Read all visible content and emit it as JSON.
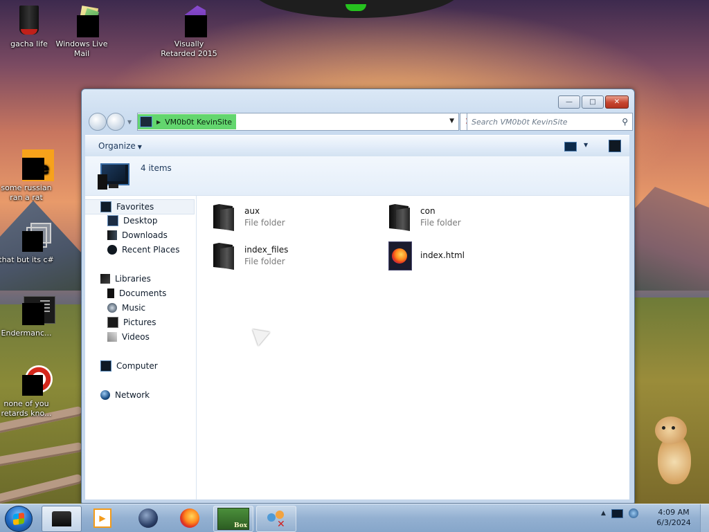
{
  "desktop": {
    "icons": [
      {
        "label": "gacha life",
        "icon": "trash-can-icon"
      },
      {
        "label": "Windows Live Mail",
        "icon": "mail-icon"
      },
      {
        "label": "Visually Retarded 2015",
        "icon": "visual-studio-icon"
      },
      {
        "label": "some russian ran a rat",
        "icon": "app-icon"
      },
      {
        "label": "that but its c#",
        "icon": "app-icon"
      },
      {
        "label": "Endermanc...",
        "icon": "app-icon"
      },
      {
        "label": "none of you retards kno...",
        "icon": "app-icon"
      }
    ]
  },
  "explorer": {
    "address": {
      "segment": "VM0b0t KevinSite"
    },
    "search": {
      "placeholder": "Search VM0b0t KevinSite"
    },
    "toolbar": {
      "organize_label": "Organize"
    },
    "details": {
      "items_count": "4 items"
    },
    "nav": {
      "favorites": {
        "label": "Favorites",
        "items": [
          "Desktop",
          "Downloads",
          "Recent Places"
        ]
      },
      "libraries": {
        "label": "Libraries",
        "items": [
          "Documents",
          "Music",
          "Pictures",
          "Videos"
        ]
      },
      "computer": {
        "label": "Computer"
      },
      "network": {
        "label": "Network"
      }
    },
    "files": [
      {
        "name": "aux",
        "type": "File folder"
      },
      {
        "name": "con",
        "type": "File folder"
      },
      {
        "name": "index_files",
        "type": "File folder"
      },
      {
        "name": "index.html",
        "type": ""
      }
    ]
  },
  "taskbar": {
    "clock": {
      "time": "4:09 AM",
      "date": "6/3/2024"
    },
    "box_label": "Box"
  },
  "colors": {
    "address_highlight": "#63d66e",
    "close_button": "#c6452f",
    "taskbar": "#93b0d1"
  }
}
